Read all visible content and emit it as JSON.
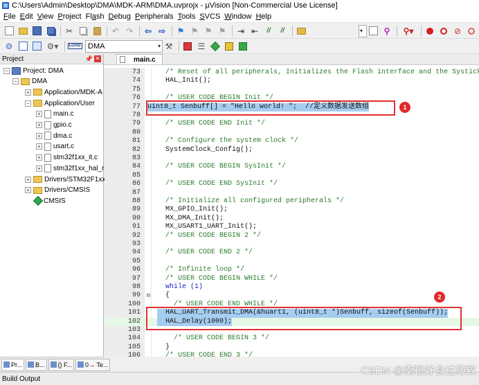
{
  "window": {
    "title": "C:\\Users\\Admin\\Desktop\\DMA\\MDK-ARM\\DMA.uvprojx - µVision  [Non-Commercial Use License]"
  },
  "menu": [
    {
      "label": "File",
      "mnemonic": "F",
      "rest": "ile"
    },
    {
      "label": "Edit",
      "mnemonic": "E",
      "rest": "dit"
    },
    {
      "label": "View",
      "mnemonic": "V",
      "rest": "iew"
    },
    {
      "label": "Project",
      "mnemonic": "P",
      "rest": "roject"
    },
    {
      "label": "Flash",
      "mnemonic": "a",
      "pre": "Fl",
      "rest": "sh"
    },
    {
      "label": "Debug",
      "mnemonic": "D",
      "rest": "ebug"
    },
    {
      "label": "Peripherals",
      "mnemonic": "P",
      "rest": "eripherals"
    },
    {
      "label": "Tools",
      "mnemonic": "T",
      "rest": "ools"
    },
    {
      "label": "SVCS",
      "mnemonic": "S",
      "rest": "VCS"
    },
    {
      "label": "Window",
      "mnemonic": "W",
      "rest": "indow"
    },
    {
      "label": "Help",
      "mnemonic": "H",
      "rest": "elp"
    }
  ],
  "toolbar2": {
    "target_value": "DMA",
    "load_label": "LOAD"
  },
  "project_panel": {
    "title": "Project",
    "tree": [
      {
        "label": "Project: DMA",
        "icon": "project-icon",
        "expander": "minus",
        "level": 0
      },
      {
        "label": "DMA",
        "icon": "target-folder-icon",
        "expander": "minus",
        "level": 1
      },
      {
        "label": "Application/MDK-A",
        "icon": "folder-icon",
        "expander": "plus",
        "level": 2
      },
      {
        "label": "Application/User",
        "icon": "folder-icon",
        "expander": "minus",
        "level": 2
      },
      {
        "label": "main.c",
        "icon": "file-icon",
        "expander": "plus",
        "level": 3
      },
      {
        "label": "gpio.c",
        "icon": "file-icon",
        "expander": "plus",
        "level": 3
      },
      {
        "label": "dma.c",
        "icon": "file-icon",
        "expander": "plus",
        "level": 3
      },
      {
        "label": "usart.c",
        "icon": "file-icon",
        "expander": "plus",
        "level": 3
      },
      {
        "label": "stm32f1xx_it.c",
        "icon": "file-icon",
        "expander": "plus",
        "level": 3
      },
      {
        "label": "stm32f1xx_hal_r",
        "icon": "file-icon",
        "expander": "plus",
        "level": 3
      },
      {
        "label": "Drivers/STM32F1xx_",
        "icon": "folder-icon",
        "expander": "plus",
        "level": 2
      },
      {
        "label": "Drivers/CMSIS",
        "icon": "folder-icon",
        "expander": "plus",
        "level": 2
      },
      {
        "label": "CMSIS",
        "icon": "cmsis-gem-icon",
        "expander": "none",
        "level": 2
      }
    ],
    "tabs": [
      {
        "label": "Pr..."
      },
      {
        "label": "B..."
      },
      {
        "label": "{} F..."
      },
      {
        "label": "0→ Te..."
      }
    ]
  },
  "editor": {
    "tab_label": "main.c",
    "lines": [
      {
        "n": "73",
        "text": "  /* Reset of all peripherals, Initializes the Flash interface and the Systick. */",
        "kind": "comment"
      },
      {
        "n": "74",
        "text": "  HAL_Init();",
        "kind": "normal"
      },
      {
        "n": "75",
        "text": "",
        "kind": "normal"
      },
      {
        "n": "76",
        "text": "  /* USER CODE BEGIN Init */",
        "kind": "comment"
      },
      {
        "n": "77",
        "text": "uint8_t Senbuff[] = \"Hello world! \";  //定义数据发送数组",
        "kind": "selected"
      },
      {
        "n": "78",
        "text": "",
        "kind": "normal"
      },
      {
        "n": "79",
        "text": "  /* USER CODE END Init */",
        "kind": "comment"
      },
      {
        "n": "80",
        "text": "",
        "kind": "normal"
      },
      {
        "n": "81",
        "text": "  /* Configure the system clock */",
        "kind": "comment"
      },
      {
        "n": "82",
        "text": "  SystemClock_Config();",
        "kind": "normal"
      },
      {
        "n": "83",
        "text": "",
        "kind": "normal"
      },
      {
        "n": "84",
        "text": "  /* USER CODE BEGIN SysInit */",
        "kind": "comment"
      },
      {
        "n": "85",
        "text": "",
        "kind": "normal"
      },
      {
        "n": "86",
        "text": "  /* USER CODE END SysInit */",
        "kind": "comment"
      },
      {
        "n": "87",
        "text": "",
        "kind": "normal"
      },
      {
        "n": "88",
        "text": "  /* Initialize all configured peripherals */",
        "kind": "comment"
      },
      {
        "n": "89",
        "text": "  MX_GPIO_Init();",
        "kind": "normal"
      },
      {
        "n": "90",
        "text": "  MX_DMA_Init();",
        "kind": "normal"
      },
      {
        "n": "91",
        "text": "  MX_USART1_UART_Init();",
        "kind": "normal"
      },
      {
        "n": "92",
        "text": "  /* USER CODE BEGIN 2 */",
        "kind": "comment"
      },
      {
        "n": "93",
        "text": "",
        "kind": "normal"
      },
      {
        "n": "94",
        "text": "  /* USER CODE END 2 */",
        "kind": "comment"
      },
      {
        "n": "95",
        "text": "",
        "kind": "normal"
      },
      {
        "n": "96",
        "text": "  /* Infinite loop */",
        "kind": "comment"
      },
      {
        "n": "97",
        "text": "  /* USER CODE BEGIN WHILE */",
        "kind": "comment"
      },
      {
        "n": "98",
        "text": "  while (1)",
        "kind": "keyword"
      },
      {
        "n": "99",
        "text": "  {",
        "kind": "normal",
        "fold": "-"
      },
      {
        "n": "100",
        "text": "    /* USER CODE END WHILE */",
        "kind": "comment"
      },
      {
        "n": "101",
        "text": "  HAL_UART_Transmit_DMA(&huart1, (uint8_t *)Senbuff, sizeof(Senbuff));",
        "kind": "selected"
      },
      {
        "n": "102",
        "text": "  HAL_Delay(1000);",
        "kind": "selected-current"
      },
      {
        "n": "103",
        "text": "",
        "kind": "normal"
      },
      {
        "n": "104",
        "text": "    /* USER CODE BEGIN 3 */",
        "kind": "comment"
      },
      {
        "n": "105",
        "text": "  }",
        "kind": "normal"
      },
      {
        "n": "106",
        "text": "  /* USER CODE END 3 */",
        "kind": "comment"
      }
    ]
  },
  "annotations": [
    {
      "label": "1"
    },
    {
      "label": "2"
    }
  ],
  "bottom": {
    "build_output": "Build Output"
  },
  "watermark": "CSDN @南粉好食过薄欸",
  "colors": {
    "selection": "#a5cdf0",
    "comment": "#2b7b2b",
    "keyword": "#2222cc",
    "annotation_red": "#e03030",
    "current_line": "#e5f7e5"
  }
}
